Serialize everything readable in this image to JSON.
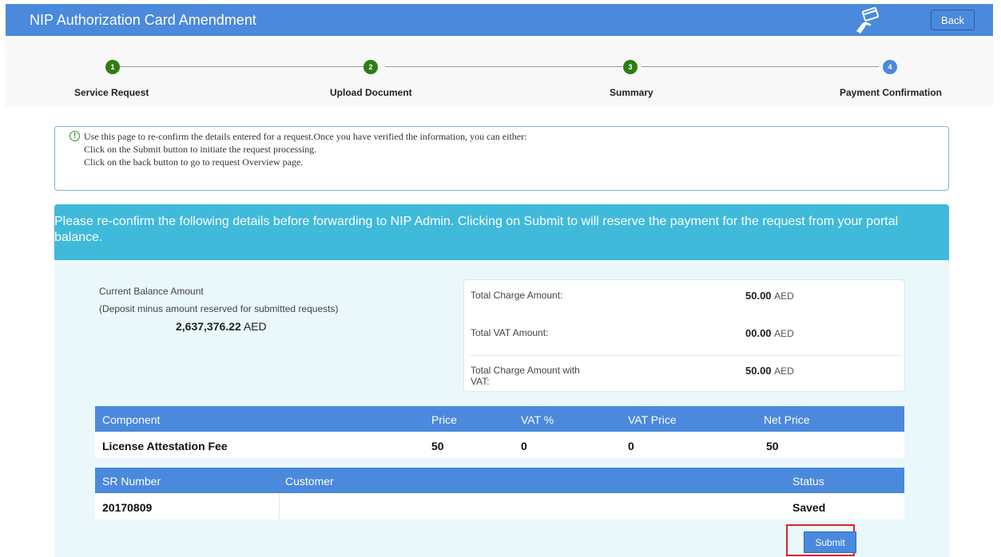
{
  "header": {
    "title": "NIP Authorization Card Amendment",
    "back_label": "Back",
    "icon": "card-payment-icon",
    "bar_color": "#4a89dc"
  },
  "stepper": {
    "steps": [
      {
        "number": "1",
        "label": "Service Request",
        "state": "done"
      },
      {
        "number": "2",
        "label": "Upload Document",
        "state": "done"
      },
      {
        "number": "3",
        "label": "Summary",
        "state": "done"
      },
      {
        "number": "4",
        "label": "Payment Confirmation",
        "state": "active"
      }
    ],
    "done_color": "#2e7d0f",
    "active_color": "#4a89dc"
  },
  "info": {
    "icon": "info-circle-icon",
    "lines": [
      "Use this page to re-confirm the details entered for a request.Once you have verified the information, you can either:",
      "Click on the Submit button to initiate the request processing.",
      "Click on the back button to go to request Overview page."
    ]
  },
  "banner": {
    "text": "Please re-confirm the following details before forwarding to NIP Admin. Clicking on Submit to will reserve the payment for the request from your portal balance.",
    "color": "#3fbadb"
  },
  "balance": {
    "label": "Current Balance Amount",
    "note": "(Deposit minus amount reserved for submitted requests)",
    "amount": "2,637,376.22",
    "currency": "AED"
  },
  "charges": {
    "rows": [
      {
        "label": "Total Charge Amount:",
        "amount": "50.00",
        "currency": "AED"
      },
      {
        "label": "Total VAT Amount:",
        "amount": "00.00",
        "currency": "AED"
      },
      {
        "label": "Total Charge Amount with VAT:",
        "amount": "50.00",
        "currency": "AED"
      }
    ]
  },
  "fees_table": {
    "headers": [
      "Component",
      "Price",
      "VAT %",
      "VAT Price",
      "Net Price"
    ],
    "rows": [
      [
        "License Attestation Fee",
        "50",
        "0",
        "0",
        "50"
      ]
    ]
  },
  "sr_table": {
    "headers": [
      "SR Number",
      "Customer",
      "Status"
    ],
    "rows": [
      [
        "20170809",
        "",
        "Saved"
      ]
    ]
  },
  "actions": {
    "submit_label": "Submit"
  }
}
